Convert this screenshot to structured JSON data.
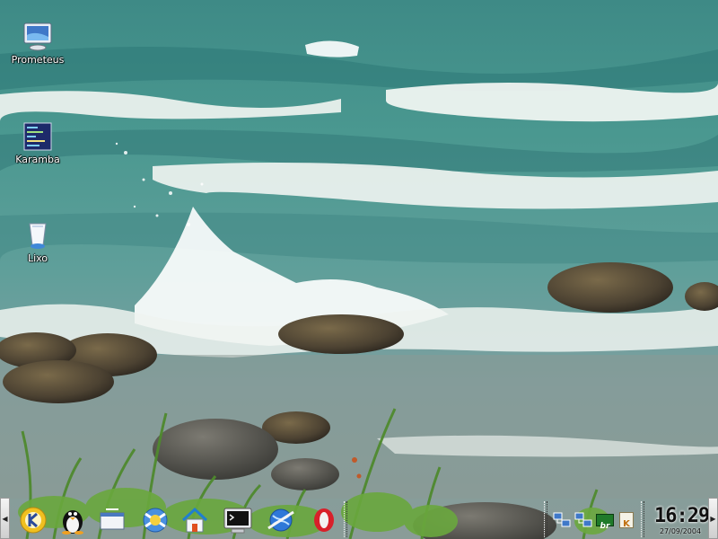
{
  "desktop": {
    "icons": [
      {
        "label": "Prometeus",
        "icon": "monitor-icon"
      },
      {
        "label": "Karamba",
        "icon": "karamba-icon"
      },
      {
        "label": "Lixo",
        "icon": "trash-icon"
      }
    ]
  },
  "panel": {
    "hide_left": "◀",
    "hide_right": "▶",
    "launchers": [
      {
        "icon": "kde-menu-icon"
      },
      {
        "icon": "tux-icon"
      },
      {
        "icon": "window-list-icon"
      },
      {
        "icon": "help-lifebuoy-icon"
      },
      {
        "icon": "home-icon"
      },
      {
        "icon": "terminal-icon"
      },
      {
        "icon": "browser-icon"
      },
      {
        "icon": "opera-icon"
      }
    ],
    "tray": [
      {
        "icon": "network-icon"
      },
      {
        "icon": "network-icon"
      },
      {
        "icon": "keyboard-layout-icon",
        "label": "br"
      },
      {
        "icon": "klipper-icon",
        "label": "K"
      }
    ],
    "clock": {
      "time": "16:29",
      "date": "27/09/2004"
    }
  },
  "colors": {
    "panel_light": "#f0f0f0",
    "clock_text": "#101010",
    "sea_light": "#6fa79a",
    "sea_dark": "#2f6f78"
  }
}
